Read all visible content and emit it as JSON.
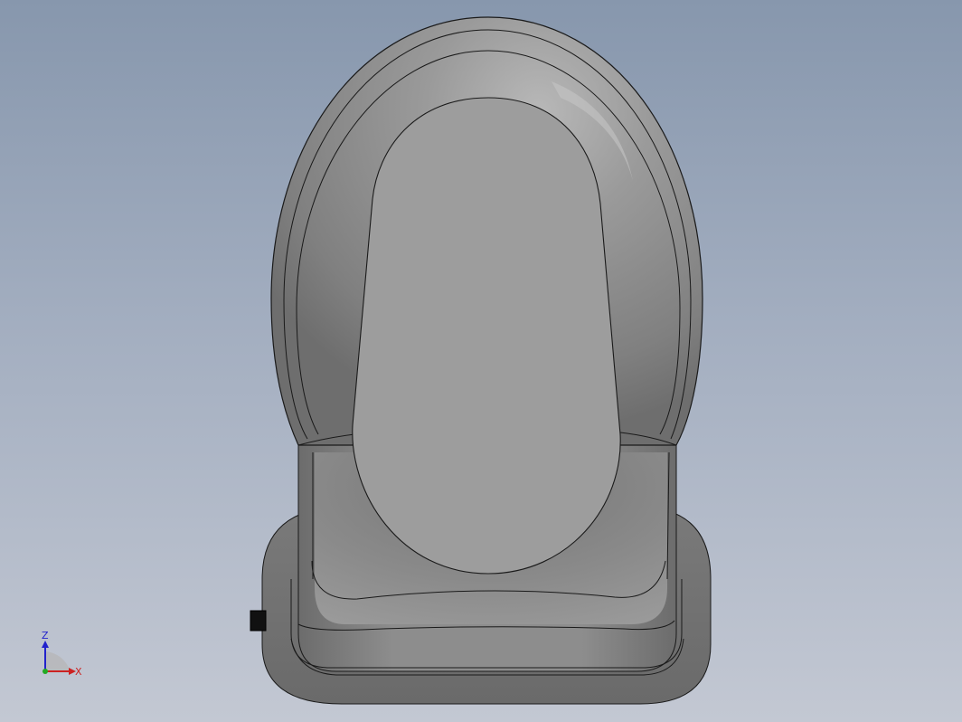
{
  "viewport": {
    "background_top": "#8797ad",
    "background_bottom": "#c3c8d3"
  },
  "model": {
    "body_color": "#8b8b8b",
    "face_color": "#9e9e9e",
    "edge_color": "#1a1a1a"
  },
  "triad": {
    "z_label": "Z",
    "x_label": "X",
    "z_color": "#2222cc",
    "x_color": "#cc2222",
    "y_color": "#22aa22"
  }
}
